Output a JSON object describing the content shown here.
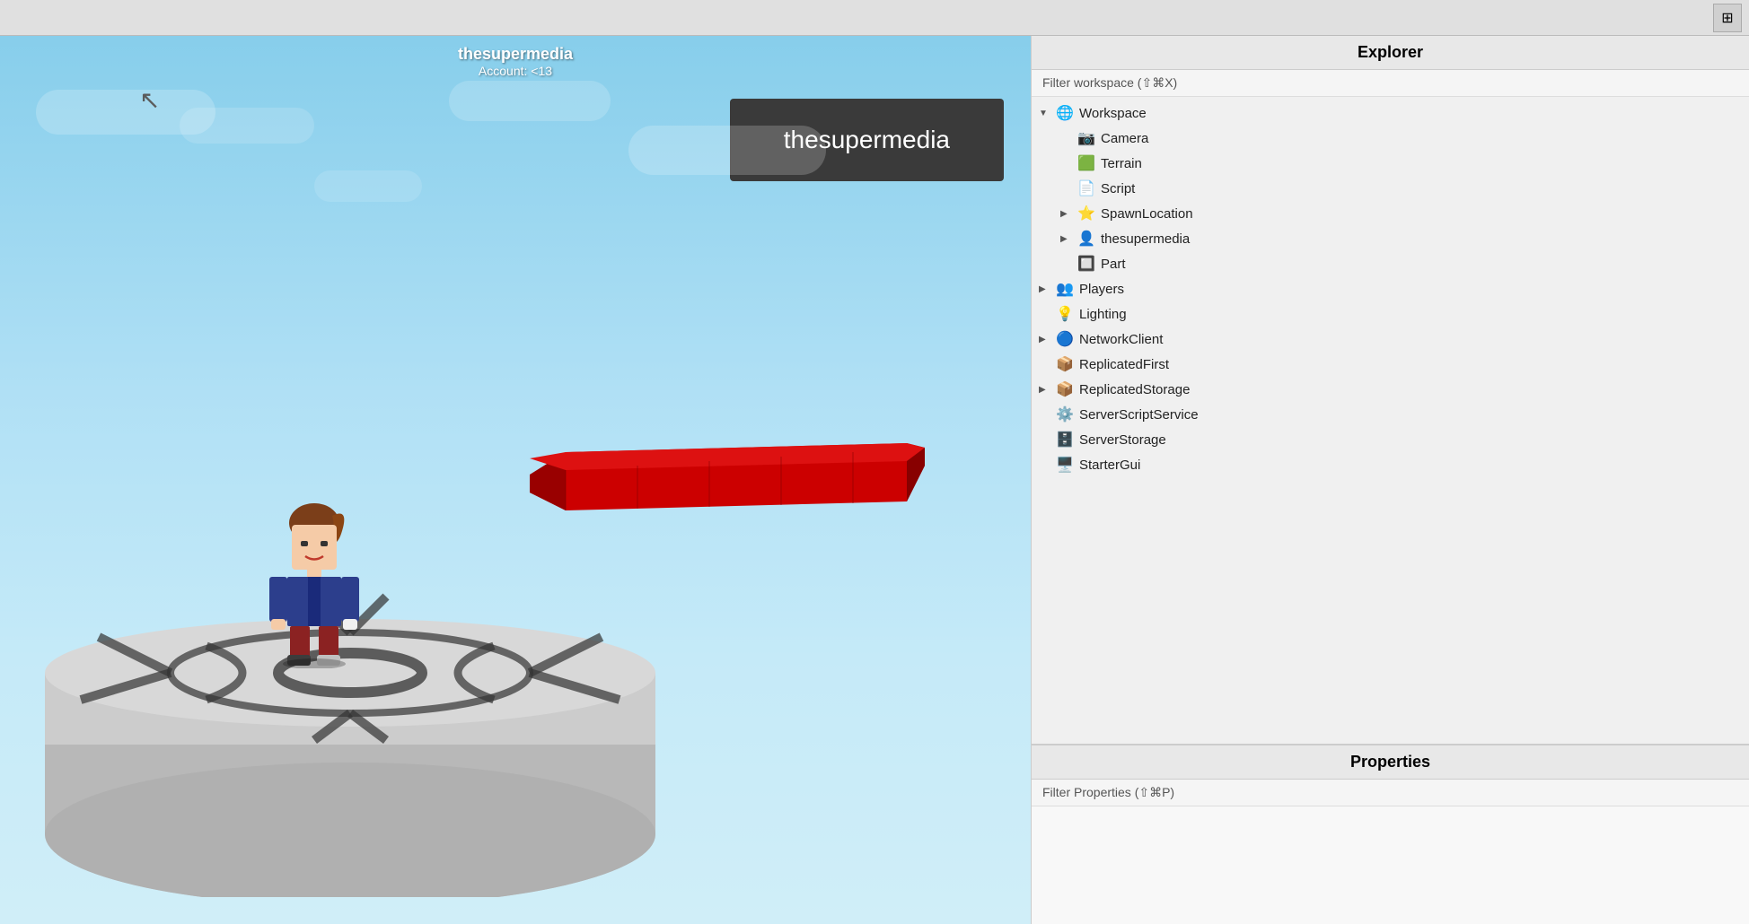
{
  "topbar": {
    "icon": "⊞"
  },
  "viewport": {
    "username": "thesupermedia",
    "account": "Account: <13",
    "username_box": "thesupermedia",
    "cursor_char": "▲"
  },
  "explorer": {
    "title": "Explorer",
    "filter_placeholder": "Filter workspace (⇧⌘X)",
    "tree": [
      {
        "id": "workspace",
        "label": "Workspace",
        "indent": 0,
        "arrow": "▼",
        "icon": "🌐",
        "expandable": true
      },
      {
        "id": "camera",
        "label": "Camera",
        "indent": 1,
        "arrow": "",
        "icon": "📷",
        "expandable": false
      },
      {
        "id": "terrain",
        "label": "Terrain",
        "indent": 1,
        "arrow": "",
        "icon": "🟩",
        "expandable": false
      },
      {
        "id": "script",
        "label": "Script",
        "indent": 1,
        "arrow": "",
        "icon": "📄",
        "expandable": false
      },
      {
        "id": "spawnlocation",
        "label": "SpawnLocation",
        "indent": 1,
        "arrow": "▶",
        "icon": "⭐",
        "expandable": true
      },
      {
        "id": "thesupermedia",
        "label": "thesupermedia",
        "indent": 1,
        "arrow": "▶",
        "icon": "👤",
        "expandable": true
      },
      {
        "id": "part",
        "label": "Part",
        "indent": 1,
        "arrow": "",
        "icon": "🔲",
        "expandable": false
      },
      {
        "id": "players",
        "label": "Players",
        "indent": 0,
        "arrow": "▶",
        "icon": "👥",
        "expandable": true
      },
      {
        "id": "lighting",
        "label": "Lighting",
        "indent": 0,
        "arrow": "",
        "icon": "💡",
        "expandable": false
      },
      {
        "id": "networkclient",
        "label": "NetworkClient",
        "indent": 0,
        "arrow": "▶",
        "icon": "🔵",
        "expandable": true
      },
      {
        "id": "replicatedfirst",
        "label": "ReplicatedFirst",
        "indent": 0,
        "arrow": "",
        "icon": "📦",
        "expandable": false
      },
      {
        "id": "replicatedstorage",
        "label": "ReplicatedStorage",
        "indent": 0,
        "arrow": "▶",
        "icon": "📦",
        "expandable": true
      },
      {
        "id": "serverscriptservice",
        "label": "ServerScriptService",
        "indent": 0,
        "arrow": "",
        "icon": "⚙️",
        "expandable": false
      },
      {
        "id": "serverstorage",
        "label": "ServerStorage",
        "indent": 0,
        "arrow": "",
        "icon": "🗄️",
        "expandable": false
      },
      {
        "id": "startergui",
        "label": "StarterGui",
        "indent": 0,
        "arrow": "",
        "icon": "🖥️",
        "expandable": false
      }
    ]
  },
  "properties": {
    "title": "Properties",
    "filter_placeholder": "Filter Properties (⇧⌘P)"
  }
}
